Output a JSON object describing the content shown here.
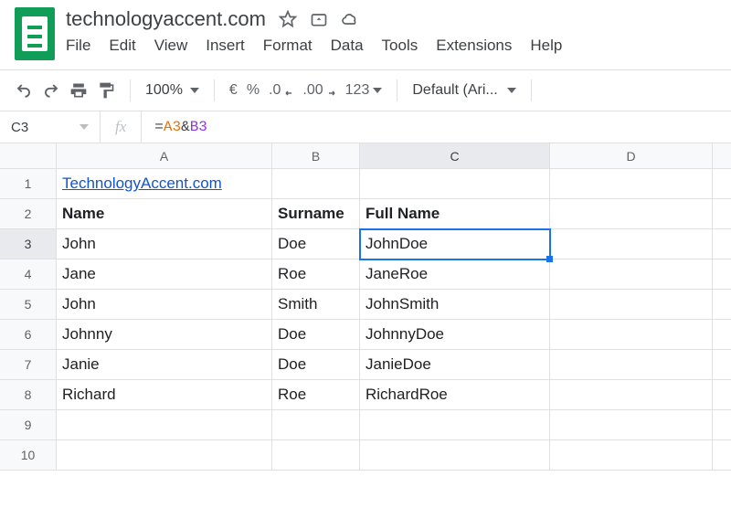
{
  "doc_title": "technologyaccent.com",
  "menu": [
    "File",
    "Edit",
    "View",
    "Insert",
    "Format",
    "Data",
    "Tools",
    "Extensions",
    "Help"
  ],
  "toolbar": {
    "zoom": "100%",
    "currency": "€",
    "percent": "%",
    "dec_dec": ".0",
    "inc_dec": ".00",
    "num_format": "123",
    "font": "Default (Ari..."
  },
  "namebox": "C3",
  "formula": {
    "eq": "=",
    "ref1": "A3",
    "amp": "&",
    "ref2": "B3"
  },
  "columns": [
    "A",
    "B",
    "C",
    "D",
    ""
  ],
  "col_widths": [
    "wA",
    "wB",
    "wC",
    "wD",
    "wE"
  ],
  "rows": [
    {
      "n": "1",
      "A": "TechnologyAccent.com",
      "B": "",
      "C": "",
      "D": "",
      "linkA": true
    },
    {
      "n": "2",
      "A": "Name",
      "B": "Surname",
      "C": "Full Name",
      "D": "",
      "bold": true
    },
    {
      "n": "3",
      "A": "John",
      "B": "Doe",
      "C": "JohnDoe",
      "D": "",
      "sel": "C"
    },
    {
      "n": "4",
      "A": "Jane",
      "B": "Roe",
      "C": "JaneRoe",
      "D": ""
    },
    {
      "n": "5",
      "A": "John",
      "B": "Smith",
      "C": "JohnSmith",
      "D": ""
    },
    {
      "n": "6",
      "A": "Johnny",
      "B": "Doe",
      "C": "JohnnyDoe",
      "D": ""
    },
    {
      "n": "7",
      "A": "Janie",
      "B": "Doe",
      "C": "JanieDoe",
      "D": ""
    },
    {
      "n": "8",
      "A": "Richard",
      "B": "Roe",
      "C": "RichardRoe",
      "D": ""
    },
    {
      "n": "9",
      "A": "",
      "B": "",
      "C": "",
      "D": ""
    },
    {
      "n": "10",
      "A": "",
      "B": "",
      "C": "",
      "D": ""
    }
  ],
  "selected_col": "C",
  "selected_row": "3"
}
